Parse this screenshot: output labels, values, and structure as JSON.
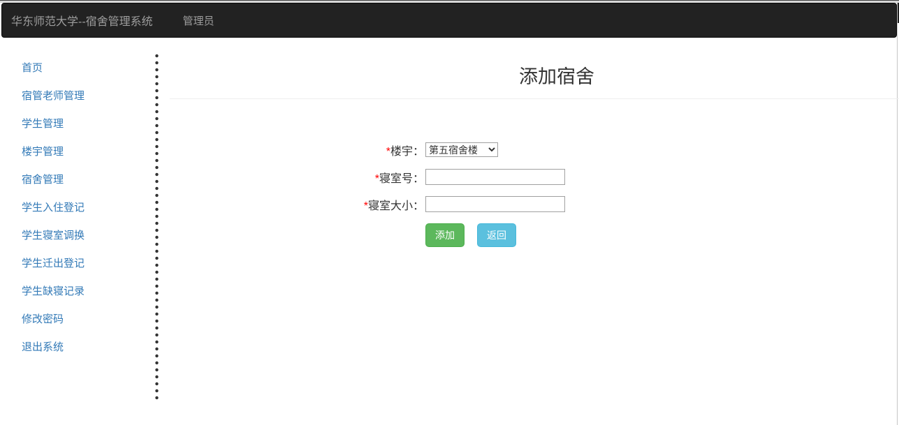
{
  "navbar": {
    "brand": "华东师范大学--宿舍管理系统",
    "user_menu": "管理员"
  },
  "sidebar": {
    "items": [
      "首页",
      "宿管老师管理",
      "学生管理",
      "楼宇管理",
      "宿舍管理",
      "学生入住登记",
      "学生寝室调换",
      "学生迁出登记",
      "学生缺寝记录",
      "修改密码",
      "退出系统"
    ]
  },
  "main": {
    "title": "添加宿舍",
    "form": {
      "required_marker": "*",
      "building": {
        "label": "楼宇：",
        "value": "第五宿舍楼"
      },
      "room_number": {
        "label": "寝室号：",
        "value": ""
      },
      "room_size": {
        "label": "寝室大小：",
        "value": ""
      },
      "add_button": "添加",
      "back_button": "返回"
    }
  },
  "colors": {
    "navbar_bg": "#222222",
    "navbar_text": "#9d9d9d",
    "sidebar_link": "#337ab7",
    "required_red": "#ff0000",
    "button_green": "#5cb85c",
    "button_blue": "#5bc0de",
    "input_border": "#a0a0a0",
    "rule_gray": "#eeeeee"
  }
}
